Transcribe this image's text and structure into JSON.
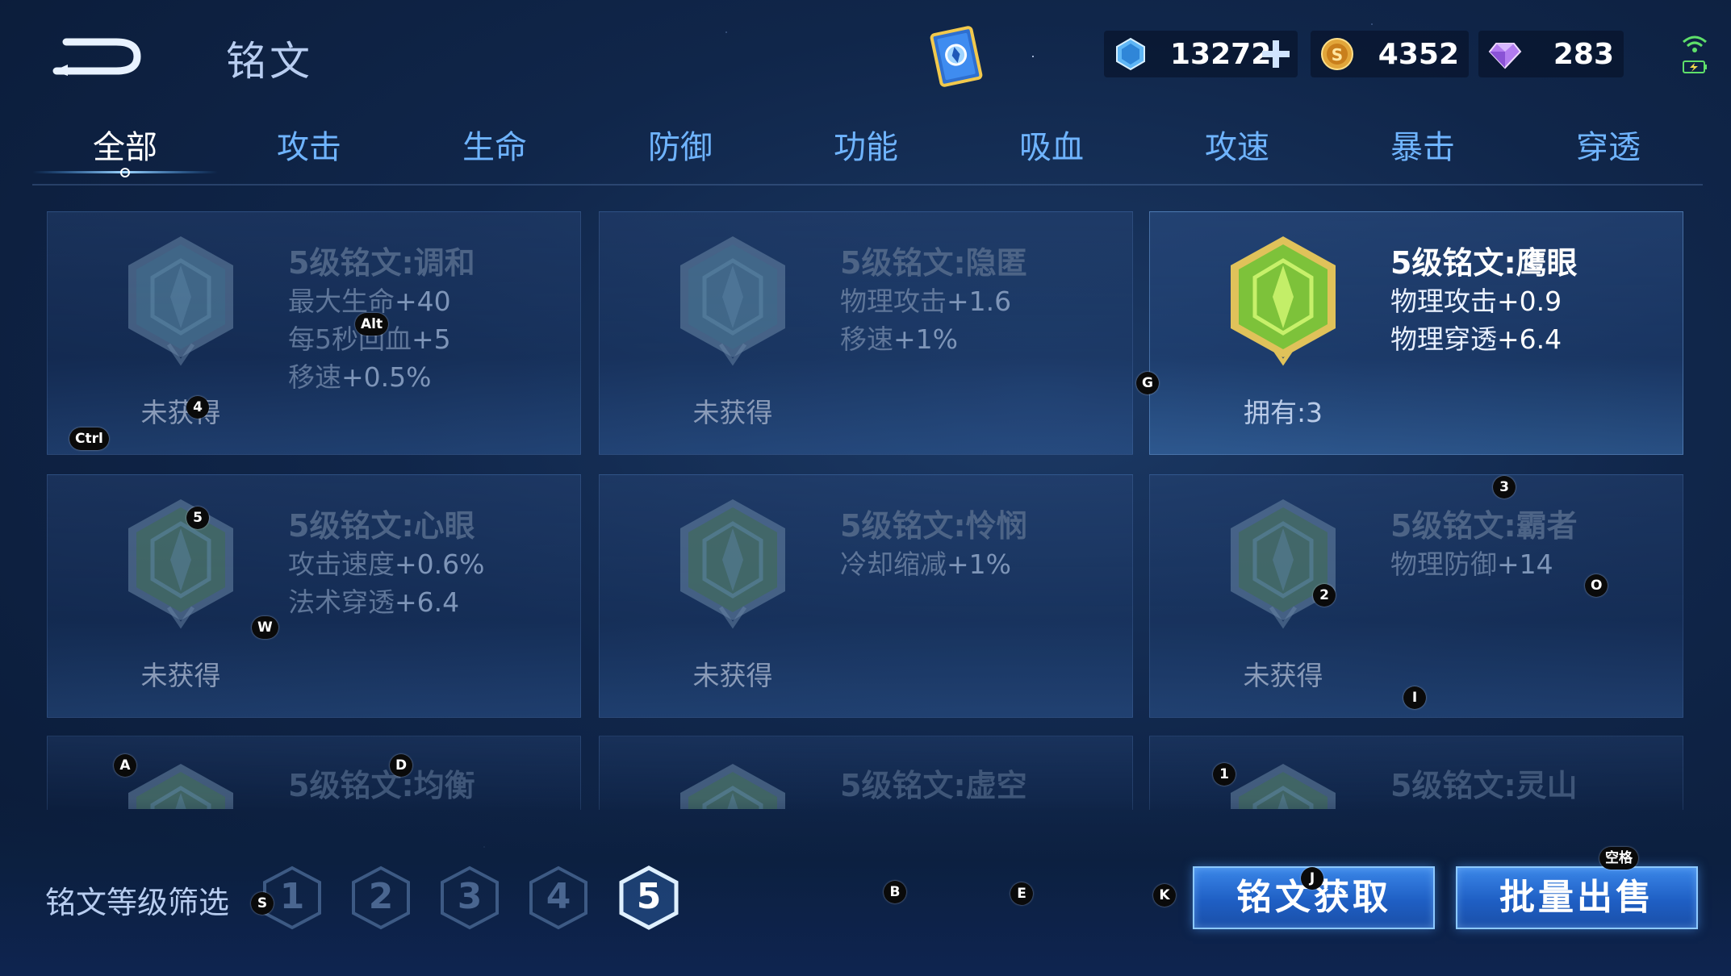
{
  "header": {
    "title": "铭文",
    "currencies": [
      {
        "icon": "blue-gem-icon",
        "value": "13272"
      },
      {
        "icon": "gold-coin-icon",
        "value": "4352"
      },
      {
        "icon": "purple-diamond-icon",
        "value": "283"
      }
    ]
  },
  "tabs": [
    {
      "label": "全部",
      "active": true
    },
    {
      "label": "攻击"
    },
    {
      "label": "生命"
    },
    {
      "label": "防御"
    },
    {
      "label": "功能"
    },
    {
      "label": "吸血"
    },
    {
      "label": "攻速"
    },
    {
      "label": "暴击"
    },
    {
      "label": "穿透"
    }
  ],
  "cards": [
    {
      "name": "5级铭文:调和",
      "attrs": [
        [
          "最大生命",
          "+40"
        ],
        [
          "每5秒回血",
          "+5"
        ],
        [
          "移速",
          "+0.5%"
        ]
      ],
      "status": "未获得",
      "owned": false,
      "emblem_color": "#3d6a8a"
    },
    {
      "name": "5级铭文:隐匿",
      "attrs": [
        [
          "物理攻击",
          "+1.6"
        ],
        [
          "移速",
          "+1%"
        ]
      ],
      "status": "未获得",
      "owned": false,
      "emblem_color": "#3d6a8a"
    },
    {
      "name": "5级铭文:鹰眼",
      "attrs": [
        [
          "物理攻击",
          "+0.9"
        ],
        [
          "物理穿透",
          "+6.4"
        ]
      ],
      "status": "拥有:3",
      "owned": true,
      "emblem_color": "#4e8a2c"
    },
    {
      "name": "5级铭文:心眼",
      "attrs": [
        [
          "攻击速度",
          "+0.6%"
        ],
        [
          "法术穿透",
          "+6.4"
        ]
      ],
      "status": "未获得",
      "owned": false,
      "emblem_color": "#3f6b55"
    },
    {
      "name": "5级铭文:怜悯",
      "attrs": [
        [
          "冷却缩减",
          "+1%"
        ]
      ],
      "status": "未获得",
      "owned": false,
      "emblem_color": "#3f6b55"
    },
    {
      "name": "5级铭文:霸者",
      "attrs": [
        [
          "物理防御",
          "+14"
        ]
      ],
      "status": "未获得",
      "owned": false,
      "emblem_color": "#3f6b55"
    },
    {
      "name": "5级铭文:均衡",
      "attrs": [],
      "status": "",
      "owned": false,
      "emblem_color": "#3f6b55"
    },
    {
      "name": "5级铭文:虚空",
      "attrs": [],
      "status": "",
      "owned": false,
      "emblem_color": "#3f6b55"
    },
    {
      "name": "5级铭文:灵山",
      "attrs": [],
      "status": "",
      "owned": false,
      "emblem_color": "#3f6b55"
    }
  ],
  "filter": {
    "label": "铭文等级筛选",
    "levels": [
      "1",
      "2",
      "3",
      "4",
      "5"
    ],
    "active_level": "5"
  },
  "buttons": {
    "obtain": "铭文获取",
    "sell": "批量出售"
  },
  "hotkeys": {
    "ctrl": "Ctrl",
    "alt": "Alt",
    "space": "空格",
    "k1": "1",
    "k2": "2",
    "k3": "3",
    "k4": "4",
    "k5": "5",
    "a": "A",
    "b": "B",
    "d": "D",
    "e": "E",
    "g": "G",
    "i": "I",
    "j": "J",
    "k": "K",
    "o": "O",
    "s": "S",
    "w": "W"
  }
}
